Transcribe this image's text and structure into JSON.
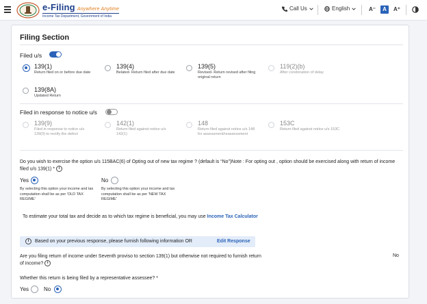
{
  "header": {
    "brand_title": "e-Filing",
    "brand_tagline": "Anywhere Anytime",
    "brand_subtitle": "Income Tax Department, Government of India",
    "call_us": "Call Us",
    "language": "English",
    "font_minus": "A⁻",
    "font_normal": "A",
    "font_plus": "A⁺",
    "icons": [
      "hamburger-icon",
      "phone-icon",
      "globe-icon",
      "contrast-icon",
      "chevron-down-icon"
    ]
  },
  "filing": {
    "title": "Filing Section",
    "filed_us_label": "Filed u/s",
    "options": [
      {
        "name": "139(1)",
        "desc": "Return filed on or before due date",
        "selected": true
      },
      {
        "name": "139(4)",
        "desc": "Belated- Return filed after due date",
        "selected": false
      },
      {
        "name": "139(5)",
        "desc": "Revised- Return revised after filing original return",
        "selected": false
      },
      {
        "name": "119(2)(b)",
        "desc": "After condonation of delay",
        "selected": false
      },
      {
        "name": "139(8A)",
        "desc": "Updated Return",
        "selected": false
      }
    ],
    "notice_label": "Filed in response to notice u/s",
    "notice_options": [
      {
        "name": "139(9)",
        "desc": "Filed in response to notice u/s 139(9) to rectify the defect"
      },
      {
        "name": "142(1)",
        "desc": "Return filed against notice u/s 142(1)"
      },
      {
        "name": "148",
        "desc": "Return filed against notice u/s 148 for assessment/reassessment"
      },
      {
        "name": "153C",
        "desc": "Return filed against notice u/s 153C"
      }
    ]
  },
  "regime": {
    "question": "Do you wish to exercise the option u/s 115BAC(6) of Opting out of new tax regime ? (default is “No”)Note : For opting out , option should be exercised along with return of income filed u/s 139(1) *",
    "yes_label": "Yes",
    "no_label": "No",
    "yes_desc": "By selecting this option your income and tax computation shall be as per 'OLD TAX REGIME'",
    "no_desc": "By selecting this option your income and tax computation shall be as per 'NEW TAX REGIME'",
    "estimate_text": "To estimate your total tax and decide as to which tax regime is beneficial, you may use",
    "calculator_link": "Income Tax Calculator"
  },
  "info": {
    "text": "Based on your previous response, please furnish following information OR",
    "edit_link": "Edit Response"
  },
  "seventh_proviso": {
    "question": "Are you filing return of income under Seventh proviso to section 139(1) but otherwise not required to furnish return of income?",
    "answer": "No"
  },
  "representative": {
    "question": "Whether this return is being filed by a representative assessee? *",
    "yes_label": "Yes",
    "no_label": "No"
  }
}
